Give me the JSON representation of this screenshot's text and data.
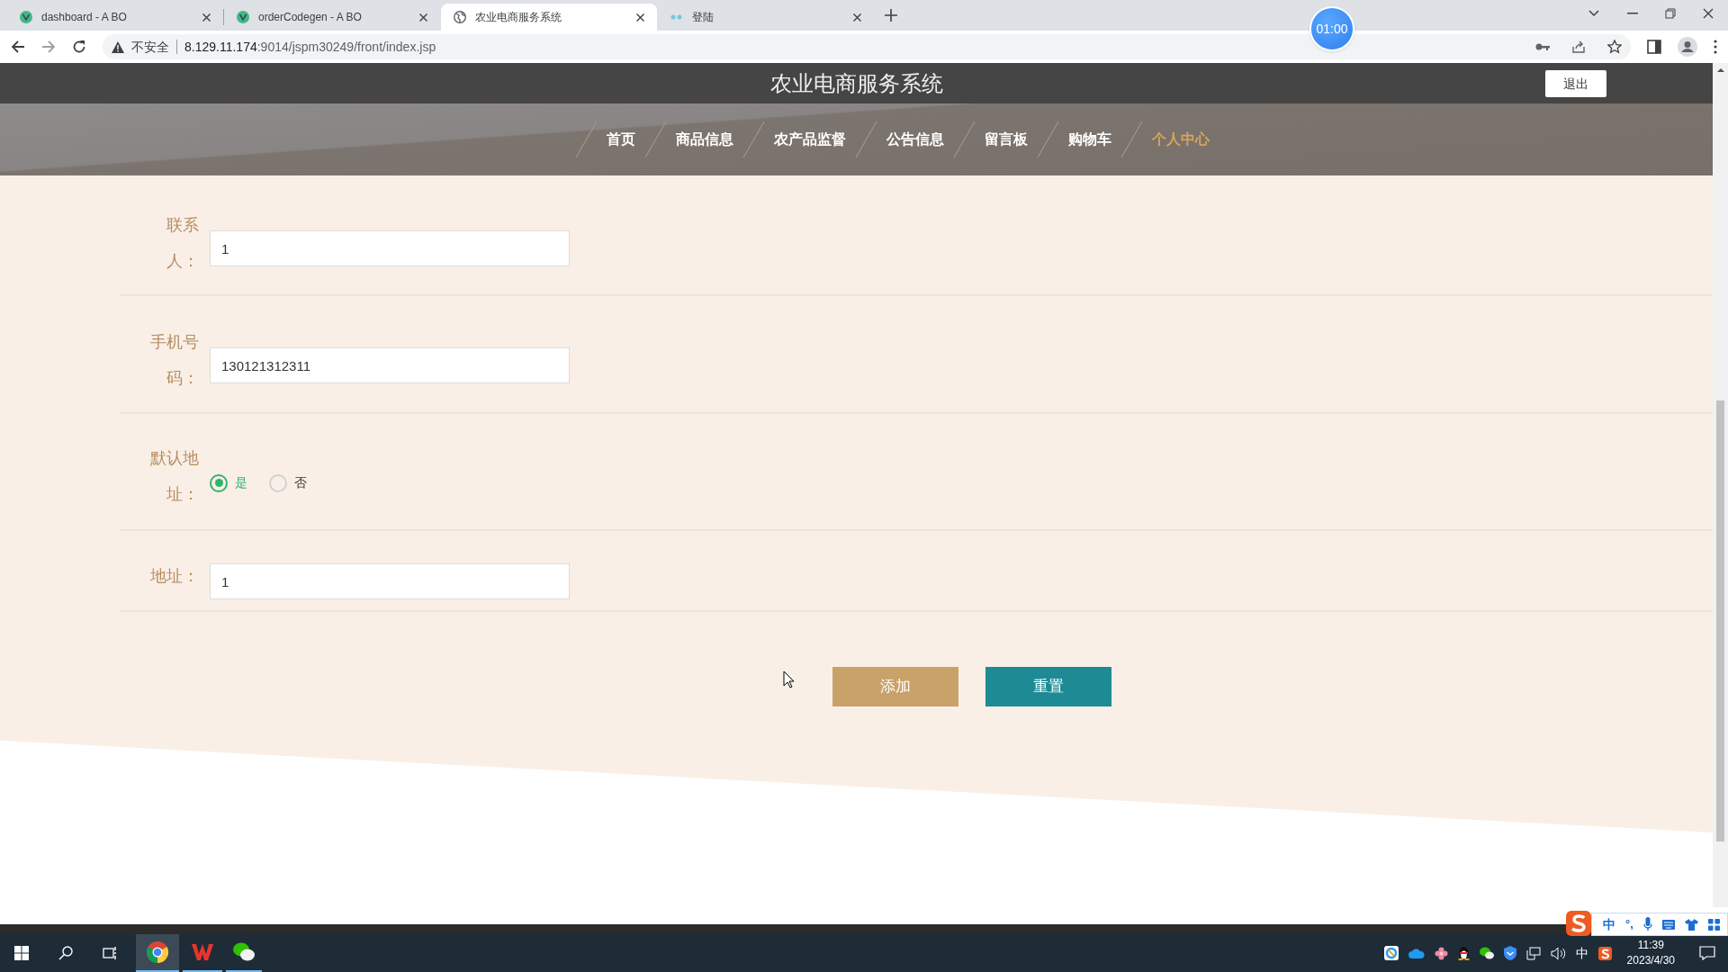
{
  "browser": {
    "tabs": [
      {
        "title": "dashboard - A BO",
        "kind": "vue",
        "selected": false
      },
      {
        "title": "orderCodegen - A BO",
        "kind": "vue",
        "selected": false
      },
      {
        "title": "农业电商服务系统",
        "kind": "globe",
        "selected": true
      },
      {
        "title": "登陆",
        "kind": "dots",
        "selected": false
      }
    ],
    "security": "不安全",
    "url_host": "8.129.11.174",
    "url_rest": ":9014/jspm30249/front/index.jsp"
  },
  "timer": "01:00",
  "site": {
    "title": "农业电商服务系统",
    "logout_button": "退出",
    "nav": [
      {
        "label": "首页",
        "selected": false
      },
      {
        "label": "商品信息",
        "selected": false
      },
      {
        "label": "农产品监督",
        "selected": false
      },
      {
        "label": "公告信息",
        "selected": false
      },
      {
        "label": "留言板",
        "selected": false
      },
      {
        "label": "购物车",
        "selected": false
      },
      {
        "label": "个人中心",
        "selected": true
      }
    ]
  },
  "form": {
    "fields": [
      {
        "kind": "text",
        "label": "联系人：",
        "value": "1"
      },
      {
        "kind": "text",
        "label": "手机号码：",
        "value": "130121312311"
      },
      {
        "kind": "radio",
        "label": "默认地址：",
        "options": [
          {
            "label": "是",
            "selected": true
          },
          {
            "label": "否",
            "selected": false
          }
        ]
      },
      {
        "kind": "text",
        "label": "地址：",
        "value": "1"
      }
    ],
    "buttons": [
      {
        "label": "添加",
        "kind": "primary"
      },
      {
        "label": "重置",
        "kind": "secondary"
      }
    ]
  },
  "ime_bar": {
    "mode": "中",
    "punctuation": "°,"
  },
  "tray": {
    "input_mode": "中",
    "time": "11:39",
    "date": "2023/4/30"
  }
}
